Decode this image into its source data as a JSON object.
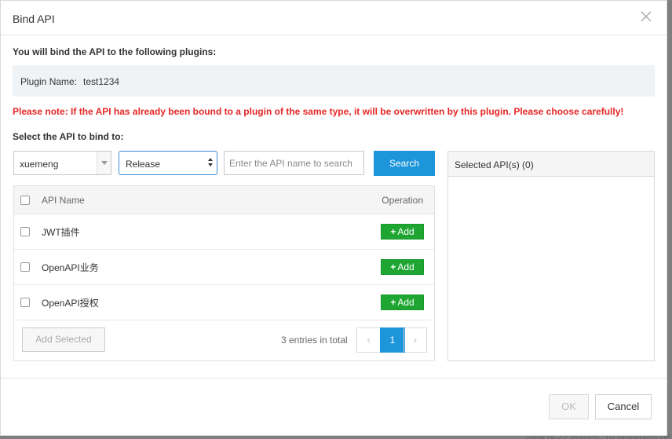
{
  "backdrop": {
    "text": "Total of 22 entries, 10 displayed pe"
  },
  "dialog": {
    "title": "Bind API",
    "close_icon": "close-icon",
    "intro": "You will bind the API to the following plugins:",
    "plugin_label": "Plugin Name:",
    "plugin_name": "test1234",
    "warning": "Please note: If the API has already been bound to a plugin of the same type, it will be overwritten by this plugin. Please choose carefully!",
    "select_title": "Select the API to bind to:"
  },
  "filters": {
    "group_value": "xuemeng",
    "stage_value": "Release",
    "search_placeholder": "Enter the API name to search",
    "search_label": "Search"
  },
  "table": {
    "col_name": "API Name",
    "col_operation": "Operation",
    "rows": [
      {
        "name": "JWT插件",
        "action": "Add"
      },
      {
        "name": "OpenAPI业务",
        "action": "Add"
      },
      {
        "name": "OpenAPI授权",
        "action": "Add"
      }
    ],
    "add_selected_label": "Add Selected",
    "total_text": "3 entries in total",
    "pager": {
      "prev": "‹",
      "current": "1",
      "next": "›"
    }
  },
  "selected": {
    "title": "Selected API(s) (0)"
  },
  "footer": {
    "ok_label": "OK",
    "cancel_label": "Cancel"
  },
  "colors": {
    "primary": "#1c95db",
    "add": "#1ea532",
    "warning": "#e62626"
  }
}
